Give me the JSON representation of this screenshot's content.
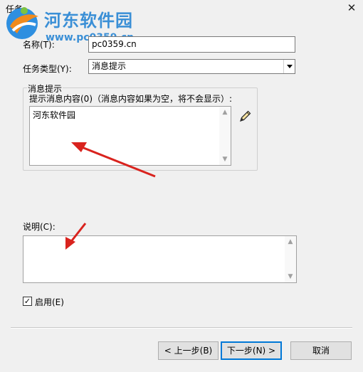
{
  "window": {
    "title": "任务",
    "close_glyph": "✕"
  },
  "watermark": {
    "site": "河东软件园",
    "url": "www.pc0359.cn"
  },
  "form": {
    "name_label": "名称(T):",
    "name_value": "pc0359.cn",
    "type_label": "任务类型(Y):",
    "type_value": "消息提示"
  },
  "message_group": {
    "legend": "消息提示",
    "prompt_label": "提示消息内容(0)（消息内容如果为空，将不会显示）:",
    "content": "河东软件园",
    "edit_icon": "pencil-icon"
  },
  "description": {
    "label": "说明(C):",
    "content": ""
  },
  "enable": {
    "label": "启用(E)",
    "checked": true,
    "check_glyph": "✓"
  },
  "buttons": {
    "back": "< 上一步(B)",
    "next": "下一步(N) >",
    "cancel": "取消"
  },
  "annotations": {
    "arrow_color": "#d9231e"
  },
  "colors": {
    "watermark": "#3a8fd6",
    "default_button_border": "#0078d7"
  }
}
